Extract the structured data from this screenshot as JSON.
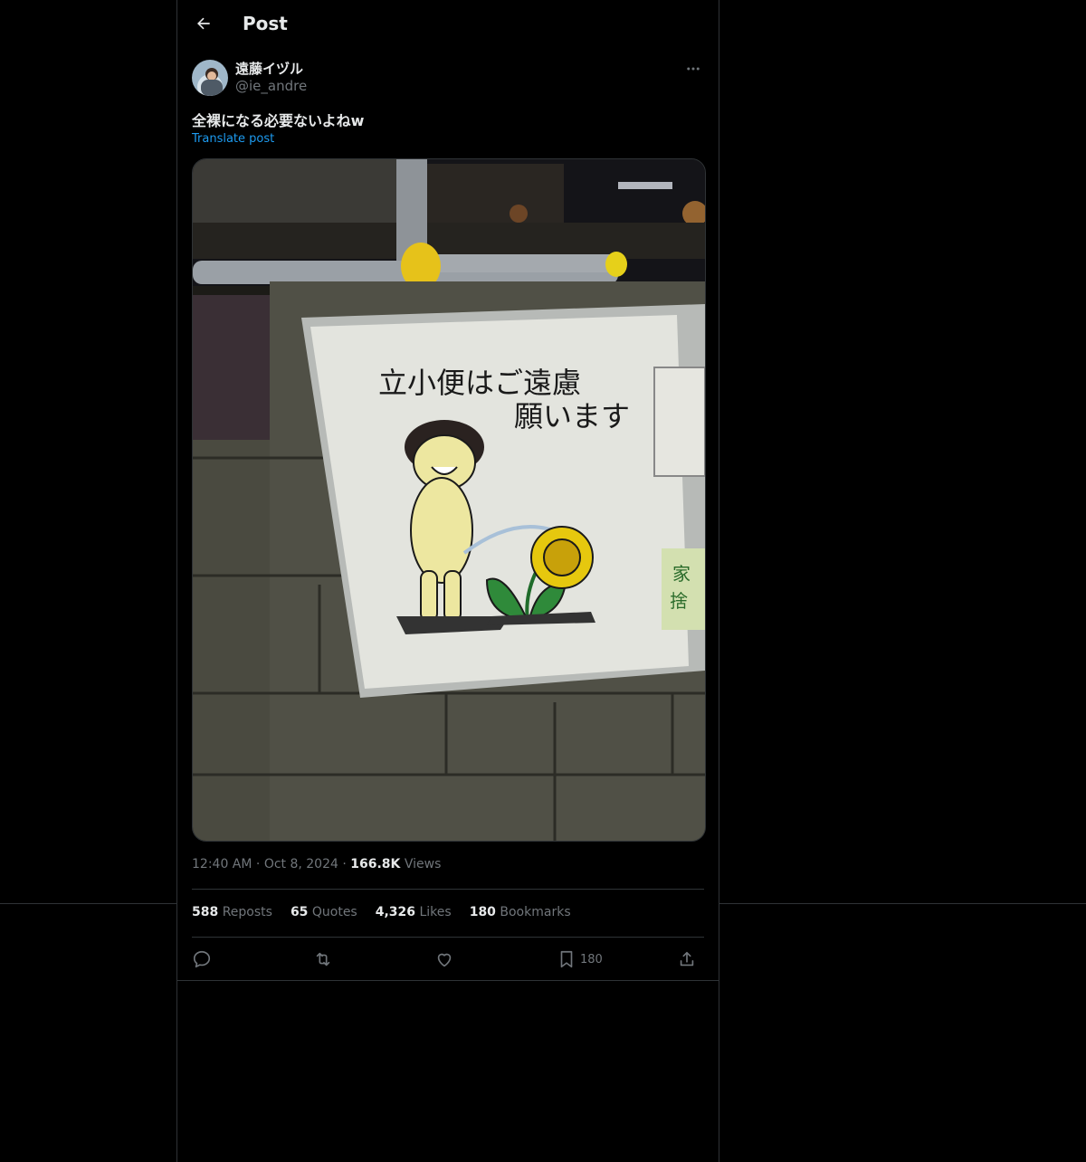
{
  "header": {
    "title": "Post"
  },
  "author": {
    "display_name": "遠藤イヅル",
    "handle": "@ie_andre"
  },
  "post": {
    "text": "全裸になる必要ないよねw",
    "translate_label": "Translate post",
    "image": {
      "sign_line1": "立小便はご遠慮",
      "sign_line2": "願います",
      "side_sign_line1": "家",
      "side_sign_line2": "捨"
    }
  },
  "meta": {
    "time": "12:40 AM",
    "date": "Oct 8, 2024",
    "views_count": "166.8K",
    "views_label": "Views"
  },
  "stats": {
    "reposts_count": "588",
    "reposts_label": "Reposts",
    "quotes_count": "65",
    "quotes_label": "Quotes",
    "likes_count": "4,326",
    "likes_label": "Likes",
    "bookmarks_count": "180",
    "bookmarks_label": "Bookmarks"
  },
  "actions": {
    "bookmark_count": "180"
  },
  "colors": {
    "background": "#000000",
    "text_primary": "#e7e9ea",
    "text_secondary": "#71767b",
    "accent": "#1d9bf0",
    "border": "#2f3336"
  }
}
